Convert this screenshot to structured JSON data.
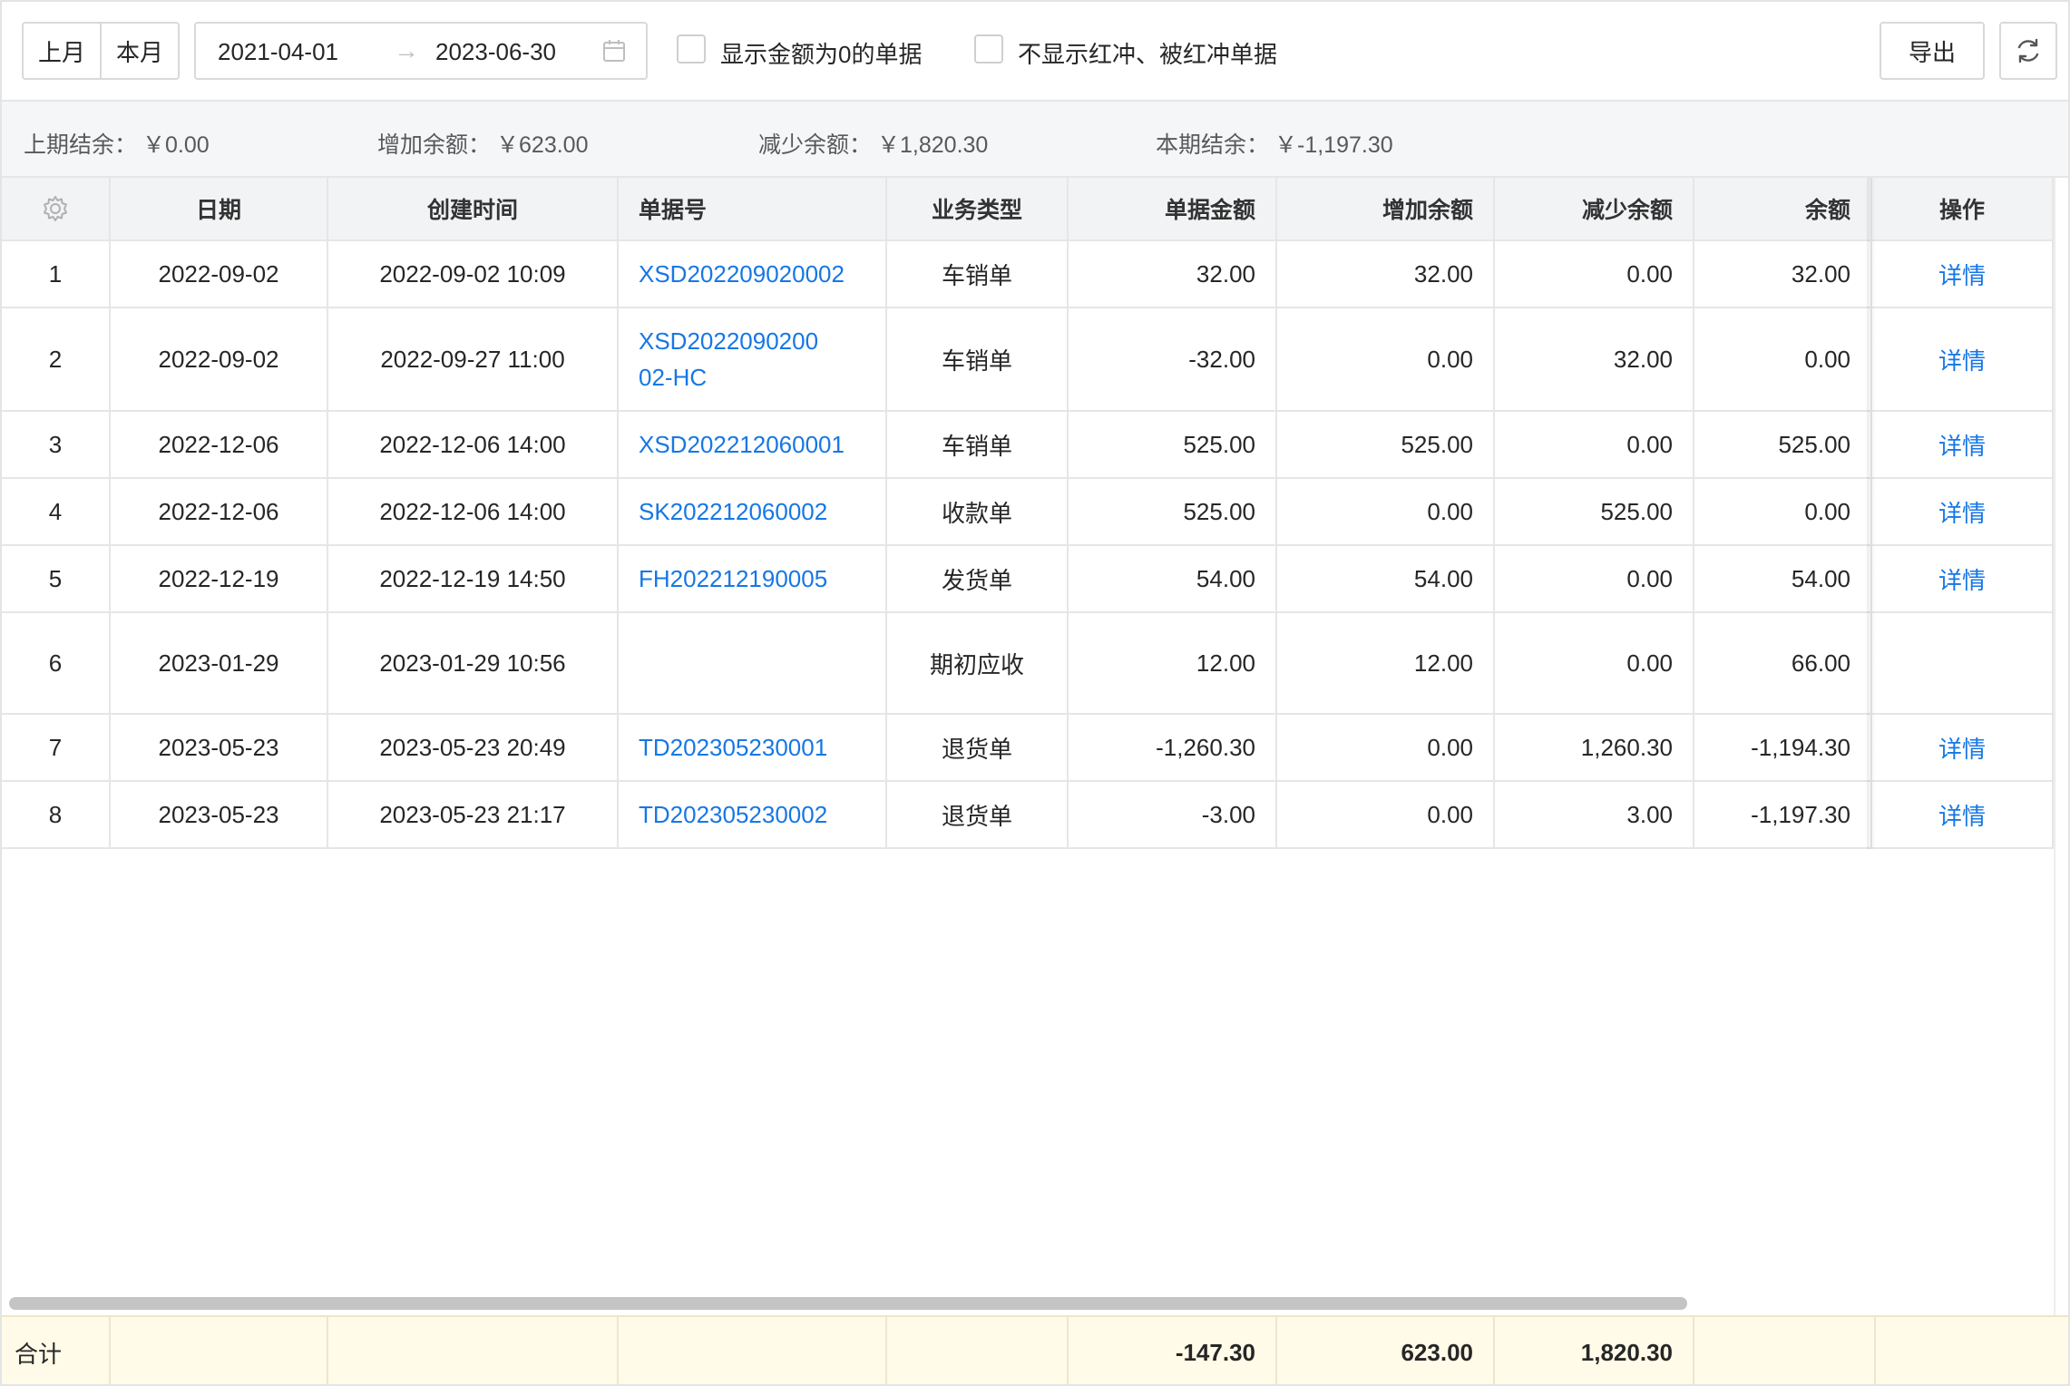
{
  "toolbar": {
    "last_month": "上月",
    "this_month": "本月",
    "date_start": "2021-04-01",
    "date_end": "2023-06-30",
    "arrow": "→",
    "show_zero_label": "显示金额为0的单据",
    "hide_red_label": "不显示红冲、被红冲单据",
    "export_label": "导出"
  },
  "summary": {
    "prev_label": "上期结余：",
    "prev_value": "￥0.00",
    "inc_label": "增加余额：",
    "inc_value": "￥623.00",
    "dec_label": "减少余额：",
    "dec_value": "￥1,820.30",
    "cur_label": "本期结余：",
    "cur_value": "￥-1,197.30"
  },
  "table": {
    "headers": {
      "date": "日期",
      "created": "创建时间",
      "doc_no": "单据号",
      "type": "业务类型",
      "amount": "单据金额",
      "increase": "增加余额",
      "decrease": "减少余额",
      "balance": "余额",
      "action": "操作"
    },
    "rows": [
      {
        "idx": "1",
        "date": "2022-09-02",
        "created": "2022-09-02 10:09",
        "doc_no": "XSD202209020002",
        "type": "车销单",
        "amount": "32.00",
        "increase": "32.00",
        "decrease": "0.00",
        "balance": "32.00",
        "action": "详情"
      },
      {
        "idx": "2",
        "date": "2022-09-02",
        "created": "2022-09-27 11:00",
        "doc_no": "XSD202209020002-HC",
        "type": "车销单",
        "amount": "-32.00",
        "increase": "0.00",
        "decrease": "32.00",
        "balance": "0.00",
        "action": "详情"
      },
      {
        "idx": "3",
        "date": "2022-12-06",
        "created": "2022-12-06 14:00",
        "doc_no": "XSD202212060001",
        "type": "车销单",
        "amount": "525.00",
        "increase": "525.00",
        "decrease": "0.00",
        "balance": "525.00",
        "action": "详情"
      },
      {
        "idx": "4",
        "date": "2022-12-06",
        "created": "2022-12-06 14:00",
        "doc_no": "SK202212060002",
        "type": "收款单",
        "amount": "525.00",
        "increase": "0.00",
        "decrease": "525.00",
        "balance": "0.00",
        "action": "详情"
      },
      {
        "idx": "5",
        "date": "2022-12-19",
        "created": "2022-12-19 14:50",
        "doc_no": "FH202212190005",
        "type": "发货单",
        "amount": "54.00",
        "increase": "54.00",
        "decrease": "0.00",
        "balance": "54.00",
        "action": "详情"
      },
      {
        "idx": "6",
        "date": "2023-01-29",
        "created": "2023-01-29 10:56",
        "doc_no": "",
        "type": "期初应收",
        "amount": "12.00",
        "increase": "12.00",
        "decrease": "0.00",
        "balance": "66.00",
        "action": ""
      },
      {
        "idx": "7",
        "date": "2023-05-23",
        "created": "2023-05-23 20:49",
        "doc_no": "TD202305230001",
        "type": "退货单",
        "amount": "-1,260.30",
        "increase": "0.00",
        "decrease": "1,260.30",
        "balance": "-1,194.30",
        "action": "详情"
      },
      {
        "idx": "8",
        "date": "2023-05-23",
        "created": "2023-05-23 21:17",
        "doc_no": "TD202305230002",
        "type": "退货单",
        "amount": "-3.00",
        "increase": "0.00",
        "decrease": "3.00",
        "balance": "-1,197.30",
        "action": "详情"
      }
    ]
  },
  "footer": {
    "label": "合计",
    "amount": "-147.30",
    "increase": "623.00",
    "decrease": "1,820.30"
  },
  "colors": {
    "link": "#1677e5",
    "header_bg": "#f2f3f5",
    "summary_bg": "#f5f6f7",
    "footer_bg": "#fffbe8"
  },
  "icons": {
    "calendar": "calendar-icon",
    "settings": "gear-icon",
    "refresh": "refresh-icon"
  }
}
